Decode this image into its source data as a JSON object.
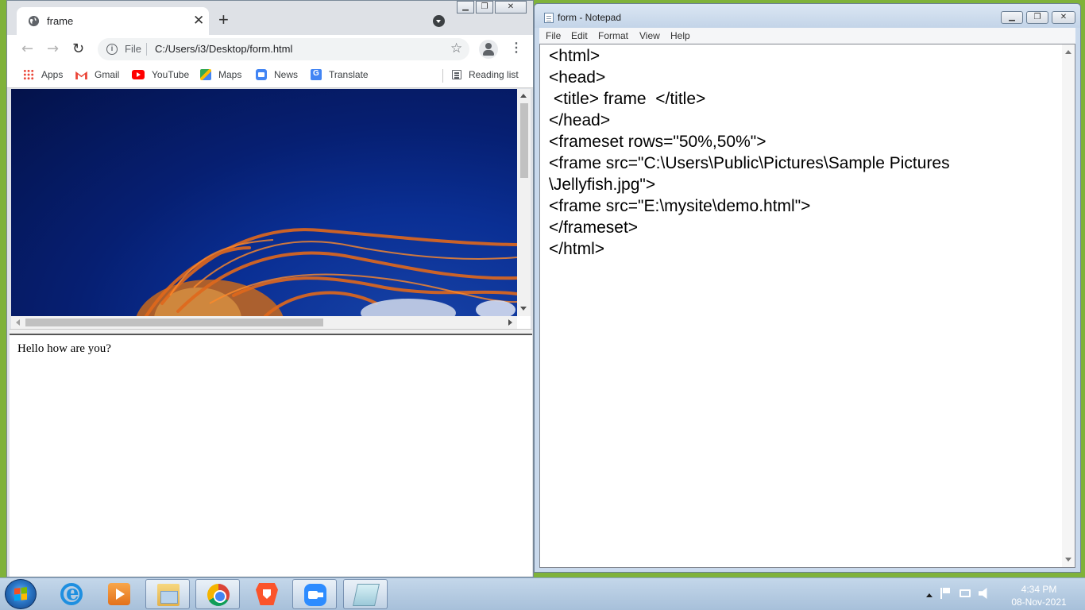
{
  "chrome": {
    "tab_title": "frame",
    "address_scheme": "File",
    "address_url": "C:/Users/i3/Desktop/form.html",
    "bookmarks": [
      {
        "label": "Apps",
        "icon": "apps-grid-icon"
      },
      {
        "label": "Gmail",
        "icon": "gmail-icon"
      },
      {
        "label": "YouTube",
        "icon": "youtube-icon"
      },
      {
        "label": "Maps",
        "icon": "maps-icon"
      },
      {
        "label": "News",
        "icon": "news-icon"
      },
      {
        "label": "Translate",
        "icon": "translate-icon"
      }
    ],
    "reading_list_label": "Reading list",
    "bottom_frame_text": "Hello how are you?"
  },
  "notepad": {
    "title": "form - Notepad",
    "menu": [
      "File",
      "Edit",
      "Format",
      "View",
      "Help"
    ],
    "content": "<html>\n<head>\n <title> frame  </title>\n</head>\n<frameset rows=\"50%,50%\">\n<frame src=\"C:\\Users\\Public\\Pictures\\Sample Pictures\n\\Jellyfish.jpg\">\n<frame src=\"E:\\mysite\\demo.html\">\n</frameset>\n</html>"
  },
  "taskbar": {
    "time": "4:34 PM",
    "date": "08-Nov-2021"
  },
  "colors": {
    "desktop": "#7fb23a",
    "jellyfish_background": "#0a2f94",
    "tentacle": "#e0681c"
  }
}
